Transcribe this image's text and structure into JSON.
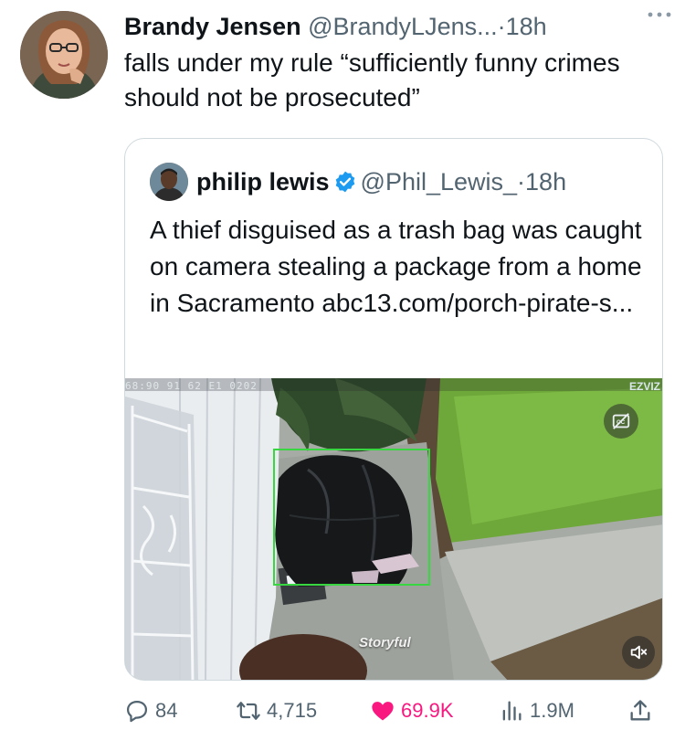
{
  "tweet": {
    "author_name": "Brandy Jensen",
    "author_handle": "@BrandyLJens...",
    "separator": "·",
    "time": "18h",
    "more_icon": "more-horizontal-icon",
    "text": "falls under my rule “sufficiently funny crimes should not be prosecuted”"
  },
  "quoted_tweet": {
    "author_name": "philip lewis",
    "verified_icon": "verified-badge-icon",
    "author_handle": "@Phil_Lewis_",
    "separator": "·",
    "time": "18h",
    "text": "A thief disguised as a trash bag was caught on camera stealing a package from a home in Sacramento abc13.com/porch-pirate-s...",
    "media": {
      "timestamp_overlay": "68:90 91 62 E1 0202",
      "camera_logo": "EZVIZ",
      "watermark": "Storyful",
      "cc_icon": "captions-off-icon",
      "mute_icon": "muted-speaker-icon"
    }
  },
  "actions": {
    "replies": "84",
    "retweets": "4,715",
    "likes": "69.9K",
    "views": "1.9M",
    "like_color": "#f91880",
    "muted_color": "#536471"
  }
}
